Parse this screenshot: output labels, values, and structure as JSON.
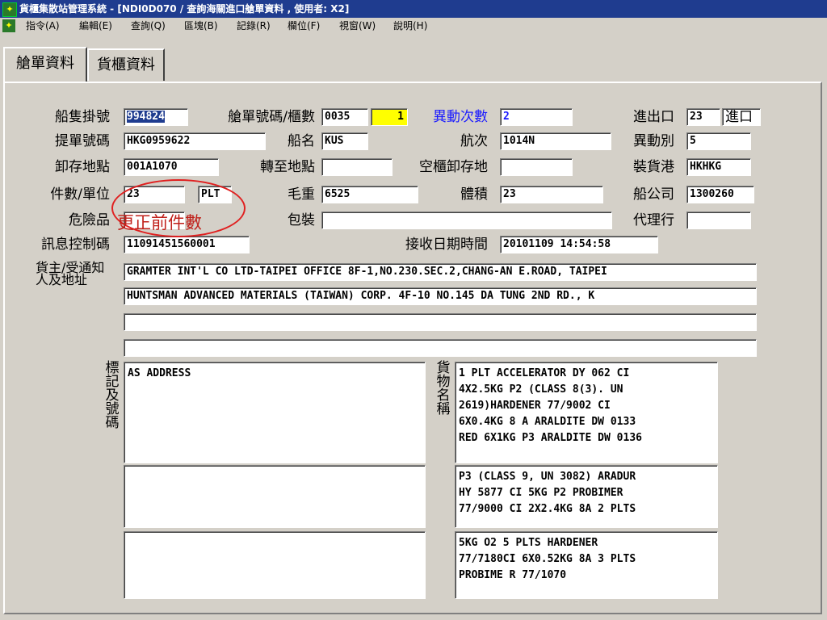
{
  "window": {
    "title": "貨櫃集散站管理系統 - [NDI0D070 / 查詢海關進口艙單資料 , 使用者: X2]"
  },
  "menu": [
    "指令(A)",
    "編輯(E)",
    "查詢(Q)",
    "區塊(B)",
    "記錄(R)",
    "欄位(F)",
    "視窗(W)",
    "說明(H)"
  ],
  "tabs": [
    {
      "label": "艙單資料"
    },
    {
      "label": "貨櫃資料"
    }
  ],
  "form": {
    "vessel_call_no_label": "船隻掛號",
    "vessel_call_no": "994824",
    "manifest_label": "艙單號碼/櫃數",
    "manifest_no": "0035",
    "container_count": "1",
    "change_count_label": "異動次數",
    "change_count": "2",
    "import_export_label": "進出口",
    "import_export_code": "23",
    "import_export_text": "進口",
    "bl_no_label": "提單號碼",
    "bl_no": "HKG0959622",
    "vessel_name_label": "船名",
    "vessel_name": "KUS",
    "voyage_label": "航次",
    "voyage": "1014N",
    "change_type_label": "異動別",
    "change_type": "5",
    "unload_place_label": "卸存地點",
    "unload_place": "001A1070",
    "transfer_place_label": "轉至地點",
    "transfer_place": "",
    "empty_unload_label": "空櫃卸存地",
    "empty_unload": "",
    "loading_port_label": "裝貨港",
    "loading_port": "HKHKG",
    "pieces_unit_label": "件數/單位",
    "pieces": "23",
    "unit": "PLT",
    "gross_weight_label": "毛重",
    "gross_weight": "6525",
    "volume_label": "體積",
    "volume": "23",
    "carrier_label": "船公司",
    "carrier": "1300260",
    "dangerous_label": "危險品",
    "dangerous": "",
    "packing_label": "包裝",
    "packing": "",
    "agent_label": "代理行",
    "agent": "",
    "msg_control_label": "訊息控制碼",
    "msg_control": "11091451560001",
    "receive_time_label": "接收日期時間",
    "receive_time": "20101109 14:54:58",
    "party_label": "貨主/受通知人及地址",
    "party_lines": [
      "GRAMTER INT'L CO LTD-TAIPEI OFFICE 8F-1,NO.230.SEC.2,CHANG-AN E.ROAD, TAIPEI",
      "HUNTSMAN ADVANCED MATERIALS (TAIWAN) CORP.  4F-10 NO.145 DA TUNG 2ND RD., K",
      "",
      ""
    ],
    "marks_label": "標記及號碼",
    "marks": [
      "AS ADDRESS",
      "",
      ""
    ],
    "goods_label": "貨物名稱",
    "goods": [
      "1 PLT ACCELERATOR DY 062 CI\n4X2.5KG P2 (CLASS 8(3). UN\n2619)HARDENER 77/9002 CI\n6X0.4KG 8 A ARALDITE DW 0133\nRED 6X1KG P3 ARALDITE DW 0136",
      "P3 (CLASS 9, UN 3082) ARADUR\nHY 5877 CI 5KG P2 PROBIMER\n77/9000 CI 2X2.4KG 8A 2 PLTS",
      "5KG O2 5 PLTS HARDENER\n77/7180CI 6X0.52KG 8A 3 PLTS\nPROBIME R 77/1070"
    ]
  },
  "annotation": {
    "text": "更正前件數",
    "color": "#e02020"
  }
}
